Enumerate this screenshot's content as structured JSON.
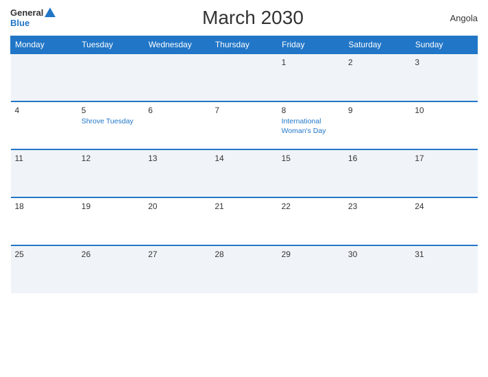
{
  "header": {
    "logo_general": "General",
    "logo_blue": "Blue",
    "title": "March 2030",
    "country": "Angola"
  },
  "weekdays": [
    {
      "label": "Monday"
    },
    {
      "label": "Tuesday"
    },
    {
      "label": "Wednesday"
    },
    {
      "label": "Thursday"
    },
    {
      "label": "Friday"
    },
    {
      "label": "Saturday"
    },
    {
      "label": "Sunday"
    }
  ],
  "rows": [
    {
      "cells": [
        {
          "day": "",
          "event": ""
        },
        {
          "day": "",
          "event": ""
        },
        {
          "day": "",
          "event": ""
        },
        {
          "day": "",
          "event": ""
        },
        {
          "day": "1",
          "event": ""
        },
        {
          "day": "2",
          "event": ""
        },
        {
          "day": "3",
          "event": ""
        }
      ]
    },
    {
      "cells": [
        {
          "day": "4",
          "event": ""
        },
        {
          "day": "5",
          "event": "Shrove Tuesday"
        },
        {
          "day": "6",
          "event": ""
        },
        {
          "day": "7",
          "event": ""
        },
        {
          "day": "8",
          "event": "International Woman's Day"
        },
        {
          "day": "9",
          "event": ""
        },
        {
          "day": "10",
          "event": ""
        }
      ]
    },
    {
      "cells": [
        {
          "day": "11",
          "event": ""
        },
        {
          "day": "12",
          "event": ""
        },
        {
          "day": "13",
          "event": ""
        },
        {
          "day": "14",
          "event": ""
        },
        {
          "day": "15",
          "event": ""
        },
        {
          "day": "16",
          "event": ""
        },
        {
          "day": "17",
          "event": ""
        }
      ]
    },
    {
      "cells": [
        {
          "day": "18",
          "event": ""
        },
        {
          "day": "19",
          "event": ""
        },
        {
          "day": "20",
          "event": ""
        },
        {
          "day": "21",
          "event": ""
        },
        {
          "day": "22",
          "event": ""
        },
        {
          "day": "23",
          "event": ""
        },
        {
          "day": "24",
          "event": ""
        }
      ]
    },
    {
      "cells": [
        {
          "day": "25",
          "event": ""
        },
        {
          "day": "26",
          "event": ""
        },
        {
          "day": "27",
          "event": ""
        },
        {
          "day": "28",
          "event": ""
        },
        {
          "day": "29",
          "event": ""
        },
        {
          "day": "30",
          "event": ""
        },
        {
          "day": "31",
          "event": ""
        }
      ]
    }
  ]
}
